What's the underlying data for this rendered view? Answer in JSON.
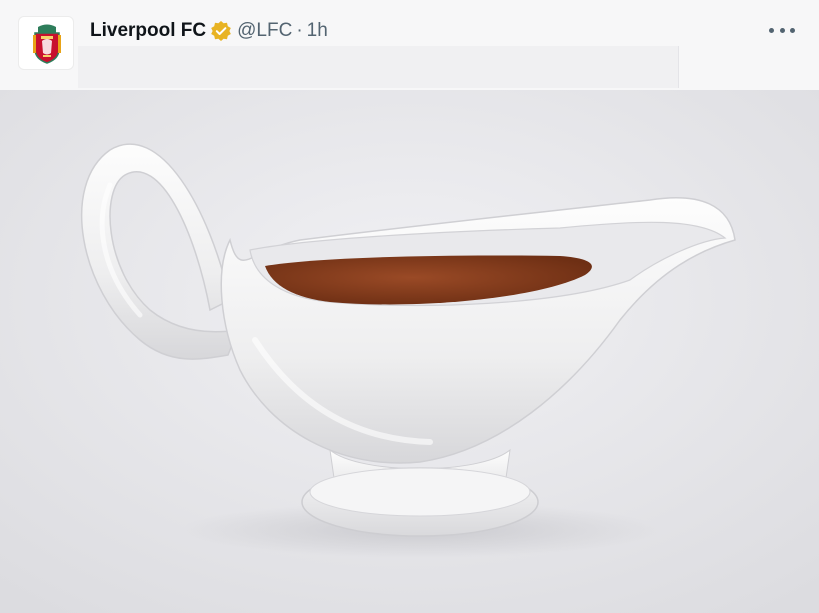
{
  "post": {
    "author": {
      "display_name": "Liverpool FC",
      "handle": "@LFC",
      "verified_badge_color": "#e8b323",
      "avatar_icon": "lfc-crest-icon"
    },
    "separator": "·",
    "time_ago": "1h",
    "more_icon": "more-horizontal-icon",
    "media": {
      "subject": "gravy-boat-image",
      "background_color": "#e7e7ea",
      "gravy_color": "#8a3e1c"
    }
  }
}
